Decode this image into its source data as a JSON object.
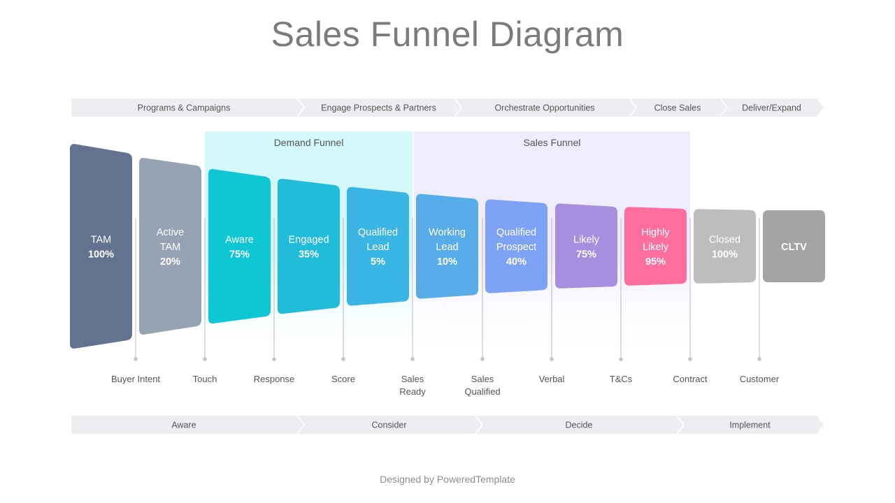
{
  "title": "Sales Funnel Diagram",
  "footer": "Designed by PoweredTemplate",
  "top_phases": [
    {
      "label": "Programs & Campaigns"
    },
    {
      "label": "Engage Prospects & Partners"
    },
    {
      "label": "Orchestrate Opportunities"
    },
    {
      "label": "Close Sales"
    },
    {
      "label": "Deliver/Expand"
    }
  ],
  "panels": [
    {
      "label": "Demand Funnel",
      "color": "#d4f7fa"
    },
    {
      "label": "Sales Funnel",
      "color": "#efedfb"
    }
  ],
  "stages": [
    {
      "name": [
        "TAM"
      ],
      "percent": "100%",
      "color": "#63738f"
    },
    {
      "name": [
        "Active",
        "TAM"
      ],
      "percent": "20%",
      "color": "#97a3b3"
    },
    {
      "name": [
        "Aware"
      ],
      "percent": "75%",
      "color": "#0ec6d4"
    },
    {
      "name": [
        "Engaged"
      ],
      "percent": "35%",
      "color": "#20bcd9"
    },
    {
      "name": [
        "Qualified",
        "Lead"
      ],
      "percent": "5%",
      "color": "#3bb5e3"
    },
    {
      "name": [
        "Working",
        "Lead"
      ],
      "percent": "10%",
      "color": "#58ade9"
    },
    {
      "name": [
        "Qualified",
        "Prospect"
      ],
      "percent": "40%",
      "color": "#7ea2f6"
    },
    {
      "name": [
        "Likely"
      ],
      "percent": "75%",
      "color": "#a78fe0"
    },
    {
      "name": [
        "Highly",
        "Likely"
      ],
      "percent": "95%",
      "color": "#fd6e9f"
    },
    {
      "name": [
        "Closed"
      ],
      "percent": "100%",
      "color": "#bdbdbd"
    },
    {
      "name": [
        "CLTV"
      ],
      "percent": "",
      "color": "#a4a4a4"
    }
  ],
  "milestones": [
    {
      "label": [
        "Buyer Intent"
      ]
    },
    {
      "label": [
        "Touch"
      ]
    },
    {
      "label": [
        "Response"
      ]
    },
    {
      "label": [
        "Score"
      ]
    },
    {
      "label": [
        "Sales",
        "Ready"
      ]
    },
    {
      "label": [
        "Sales",
        "Qualified"
      ]
    },
    {
      "label": [
        "Verbal"
      ]
    },
    {
      "label": [
        "T&Cs"
      ]
    },
    {
      "label": [
        "Contract"
      ]
    },
    {
      "label": [
        "Customer"
      ]
    }
  ],
  "bottom_phases": [
    {
      "label": "Aware"
    },
    {
      "label": "Consider"
    },
    {
      "label": "Decide"
    },
    {
      "label": "Implement"
    }
  ],
  "colors": {
    "chevron": "#eceef1",
    "line": "#c4c4c4"
  }
}
